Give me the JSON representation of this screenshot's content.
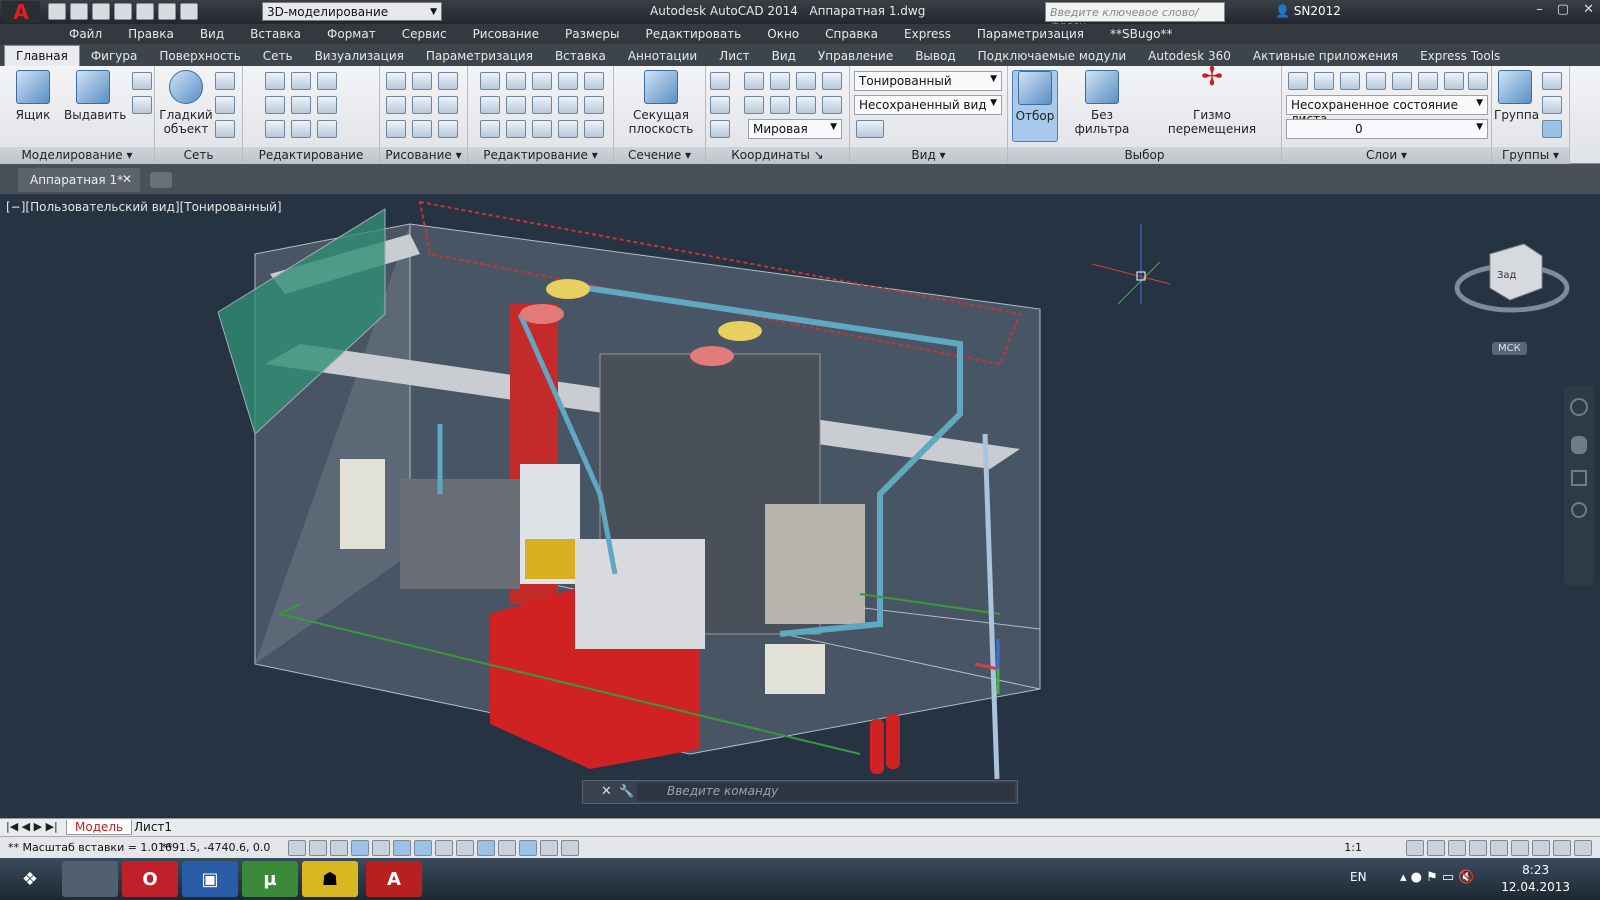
{
  "app": {
    "title": "Autodesk AutoCAD 2014",
    "document": "Аппаратная 1.dwg",
    "workspace": "3D-моделирование",
    "search_placeholder": "Введите ключевое слово/фразу",
    "user": "SN2012"
  },
  "menu": [
    "Файл",
    "Правка",
    "Вид",
    "Вставка",
    "Формат",
    "Сервис",
    "Рисование",
    "Размеры",
    "Редактировать",
    "Окно",
    "Справка",
    "Express",
    "Параметризация",
    "**SBugo**"
  ],
  "ribbon_tabs": [
    "Главная",
    "Фигура",
    "Поверхность",
    "Сеть",
    "Визуализация",
    "Параметризация",
    "Вставка",
    "Аннотации",
    "Лист",
    "Вид",
    "Управление",
    "Вывод",
    "Подключаемые модули",
    "Autodesk 360",
    "Активные приложения",
    "Express Tools"
  ],
  "panels": {
    "modeling": {
      "title": "Моделирование",
      "box": "Ящик",
      "extrude": "Выдавить"
    },
    "mesh": {
      "title": "Сеть",
      "smooth": "Гладкий объект"
    },
    "solid_edit": {
      "title": "Редактирование тела"
    },
    "draw": {
      "title": "Рисование"
    },
    "modify": {
      "title": "Редактирование"
    },
    "section": {
      "title": "Сечение",
      "plane": "Секущая плоскость"
    },
    "coordinates": {
      "title": "Координаты",
      "world": "Мировая"
    },
    "view": {
      "title": "Вид",
      "visual_style": "Тонированный",
      "named_view": "Несохраненный вид"
    },
    "selection": {
      "title": "Выбор",
      "culling": "Отбор",
      "no_filter": "Без фильтра",
      "gizmo": "Гизмо перемещения"
    },
    "layers": {
      "title": "Слои",
      "state": "Несохраненное состояние листа",
      "current": "0"
    },
    "groups": {
      "title": "Группы",
      "group": "Группа"
    }
  },
  "doc_tab": "Аппаратная 1*",
  "viewport_label": "[−][Пользовательский вид][Тонированный]",
  "viewcube": {
    "face": "Зад",
    "ucs": "МСК"
  },
  "command_placeholder": "Введите команду",
  "layout_tabs": {
    "model": "Модель",
    "sheet": "Лист1"
  },
  "status": {
    "prompt": "** Масштаб вставки = 1.0 **",
    "coords": "1691.5, -4740.6, 0.0",
    "scale": "1:1"
  },
  "tray": {
    "lang": "EN",
    "time": "8:23",
    "date": "12.04.2013"
  },
  "colors": {
    "accent": "#c81e1e",
    "viewport_bg": "#263342",
    "ribbon": "#e9ebee"
  }
}
